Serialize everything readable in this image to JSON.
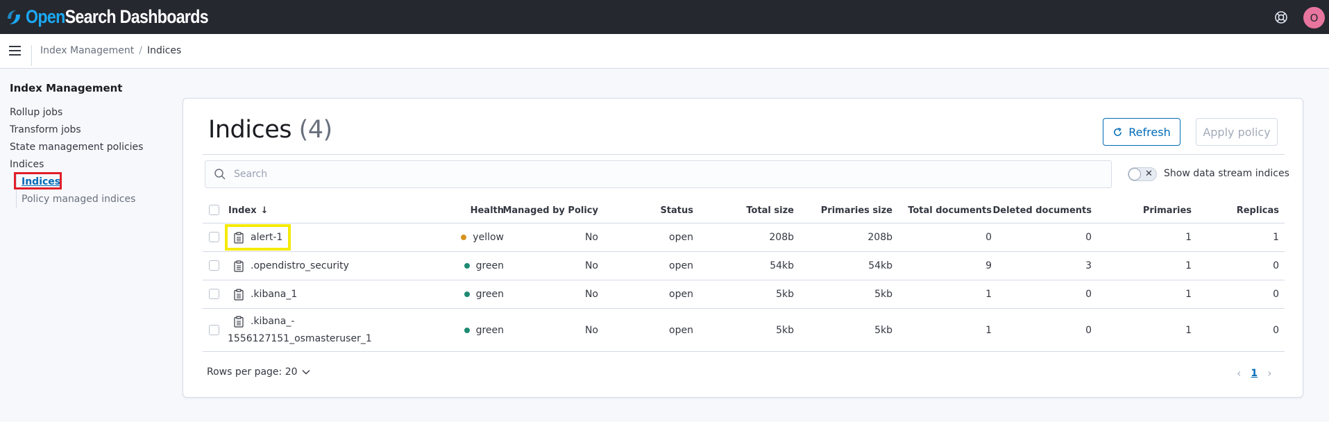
{
  "header": {
    "logo_part1": "Open",
    "logo_part2": "Search Dashboards",
    "avatar_initial": "O"
  },
  "breadcrumbs": {
    "parent": "Index Management",
    "separator": "/",
    "current": "Indices"
  },
  "sidenav": {
    "title": "Index Management",
    "items": [
      "Rollup jobs",
      "Transform jobs",
      "State management policies",
      "Indices"
    ],
    "sub_items": [
      "Indices",
      "Policy managed indices"
    ],
    "active_sub_item": "Indices"
  },
  "main": {
    "title": "Indices",
    "count": "(4)",
    "refresh_label": "Refresh",
    "apply_policy_label": "Apply policy",
    "search_placeholder": "Search",
    "toggle_label": "Show data stream indices",
    "toggle_on": false
  },
  "table": {
    "columns": {
      "index": "Index",
      "health": "Health",
      "managed": "Managed by Policy",
      "status": "Status",
      "total_size": "Total size",
      "primaries_size": "Primaries size",
      "total_documents": "Total documents",
      "deleted_documents": "Deleted documents",
      "primaries": "Primaries",
      "replicas": "Replicas"
    },
    "rows": [
      {
        "index": "alert-1",
        "health": "yellow",
        "managed": "No",
        "status": "open",
        "total_size": "208b",
        "primaries_size": "208b",
        "total_documents": "0",
        "deleted_documents": "0",
        "primaries": "1",
        "replicas": "1"
      },
      {
        "index": ".opendistro_security",
        "health": "green",
        "managed": "No",
        "status": "open",
        "total_size": "54kb",
        "primaries_size": "54kb",
        "total_documents": "9",
        "deleted_documents": "3",
        "primaries": "1",
        "replicas": "0"
      },
      {
        "index": ".kibana_1",
        "health": "green",
        "managed": "No",
        "status": "open",
        "total_size": "5kb",
        "primaries_size": "5kb",
        "total_documents": "1",
        "deleted_documents": "0",
        "primaries": "1",
        "replicas": "0"
      },
      {
        "index_line1": ".kibana_-",
        "index_line2": "1556127151_osmasteruser_1",
        "health": "green",
        "managed": "No",
        "status": "open",
        "total_size": "5kb",
        "primaries_size": "5kb",
        "total_documents": "1",
        "deleted_documents": "0",
        "primaries": "1",
        "replicas": "0"
      }
    ]
  },
  "pagination": {
    "rows_per_page_label": "Rows per page: 20",
    "current_page": "1"
  },
  "colors": {
    "header_bg": "#25282f",
    "brand_blue": "#1ba9f5",
    "link_blue": "#006bb8",
    "health_yellow": "#d6921e",
    "health_green": "#1e8a73",
    "highlight_red": "#e11d2a",
    "highlight_yellow": "#f5ea08"
  }
}
